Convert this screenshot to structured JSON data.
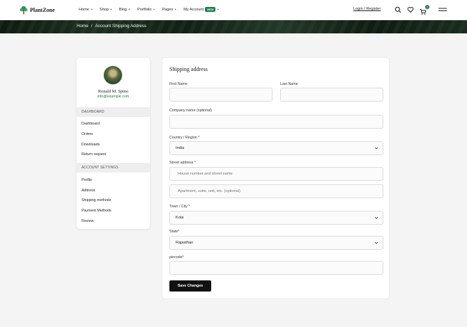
{
  "brand": {
    "name": "PlantZone",
    "accent_color": "#1f7a4d"
  },
  "nav": {
    "items": [
      {
        "label": "Home"
      },
      {
        "label": "Shop"
      },
      {
        "label": "Blog"
      },
      {
        "label": "Portfolio"
      },
      {
        "label": "Pages"
      },
      {
        "label": "My Account",
        "badge": "NEW"
      }
    ],
    "login_label": "Login / Register",
    "cart_count": "0"
  },
  "breadcrumb": {
    "home": "Home",
    "separator": "/",
    "current": "Account Shipping Address"
  },
  "user": {
    "name": "Ronald M. Spino",
    "email": "info@example.com"
  },
  "sidebar": {
    "dashboard_heading": "DASHBOARD",
    "dashboard_links": [
      "Dashboard",
      "Orders",
      "Downloads",
      "Return request"
    ],
    "settings_heading": "ACCOUNT SETTINGS",
    "settings_links": [
      "Profile",
      "Address",
      "Shipping methods",
      "Payment Methods",
      "Review"
    ]
  },
  "form": {
    "title": "Shipping address",
    "first_name": {
      "label": "First Name",
      "value": ""
    },
    "last_name": {
      "label": "Last Name",
      "value": ""
    },
    "company": {
      "label": "Company name (optional)",
      "value": ""
    },
    "country": {
      "label": "Country / Region *",
      "value": "India"
    },
    "street": {
      "label": "Street address *",
      "line1_placeholder": "House number and street name",
      "line2_placeholder": "Apartment, suite, unit, etc. (optional)"
    },
    "city": {
      "label": "Town / City *",
      "value": "Kota"
    },
    "state": {
      "label": "State*",
      "value": "Rajasthan"
    },
    "pincode": {
      "label": "pincode*",
      "value": ""
    },
    "save_label": "Save Changes"
  },
  "icons": [
    "tree-logo-icon",
    "search-icon",
    "heart-icon",
    "cart-icon",
    "hamburger-menu-icon",
    "chevron-down-icon"
  ]
}
